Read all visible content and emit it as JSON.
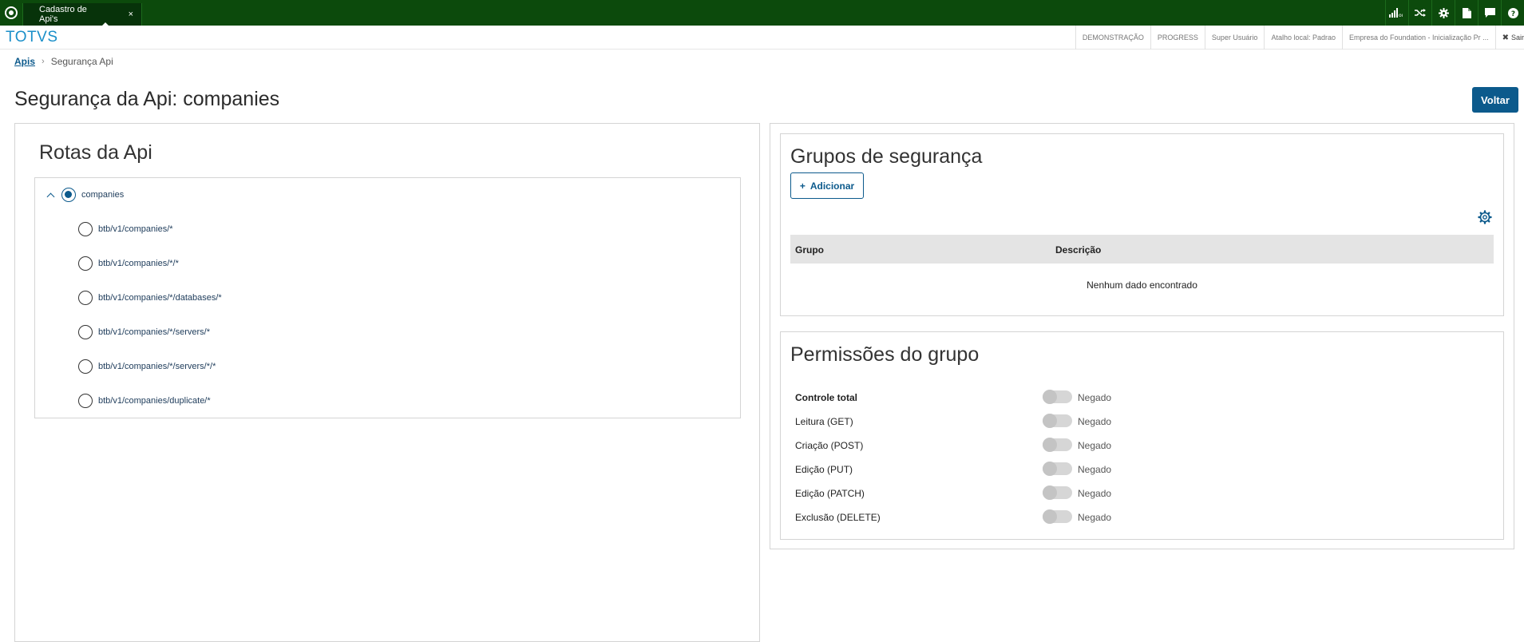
{
  "topbar": {
    "tab_label": "Cadastro de Api's",
    "tab_close": "×",
    "icons": [
      "signal-icon",
      "shuffle-icon",
      "gear-icon",
      "document-icon",
      "chat-icon",
      "help-icon"
    ]
  },
  "header": {
    "brand": "TOTVS",
    "chips": [
      "DEMONSTRAÇÃO",
      "PROGRESS",
      "Super Usuário",
      "Atalho local: Padrao",
      "Empresa do Foundation - Inicialização Pr ..."
    ],
    "exit_label": "Sair",
    "exit_icon": "✖"
  },
  "breadcrumb": {
    "link": "Apis",
    "separator": "›",
    "current": "Segurança Api"
  },
  "page": {
    "title": "Segurança da Api: companies",
    "back_button": "Voltar"
  },
  "routes": {
    "title": "Rotas da Api",
    "root": "companies",
    "items": [
      "btb/v1/companies/*",
      "btb/v1/companies/*/*",
      "btb/v1/companies/*/databases/*",
      "btb/v1/companies/*/servers/*",
      "btb/v1/companies/*/servers/*/*",
      "btb/v1/companies/duplicate/*"
    ]
  },
  "groups": {
    "title": "Grupos de segurança",
    "add_button": "Adicionar",
    "add_icon": "+",
    "columns": [
      "Grupo",
      "Descrição"
    ],
    "empty_message": "Nenhum dado encontrado"
  },
  "permissions": {
    "title": "Permissões do grupo",
    "items": [
      {
        "label": "Controle total",
        "state": "Negado"
      },
      {
        "label": "Leitura (GET)",
        "state": "Negado"
      },
      {
        "label": "Criação (POST)",
        "state": "Negado"
      },
      {
        "label": "Edição (PUT)",
        "state": "Negado"
      },
      {
        "label": "Edição (PATCH)",
        "state": "Negado"
      },
      {
        "label": "Exclusão (DELETE)",
        "state": "Negado"
      }
    ]
  },
  "colors": {
    "topbar": "#0c4a0c",
    "brand": "#1a8fc9",
    "primary": "#0c5a8c"
  }
}
